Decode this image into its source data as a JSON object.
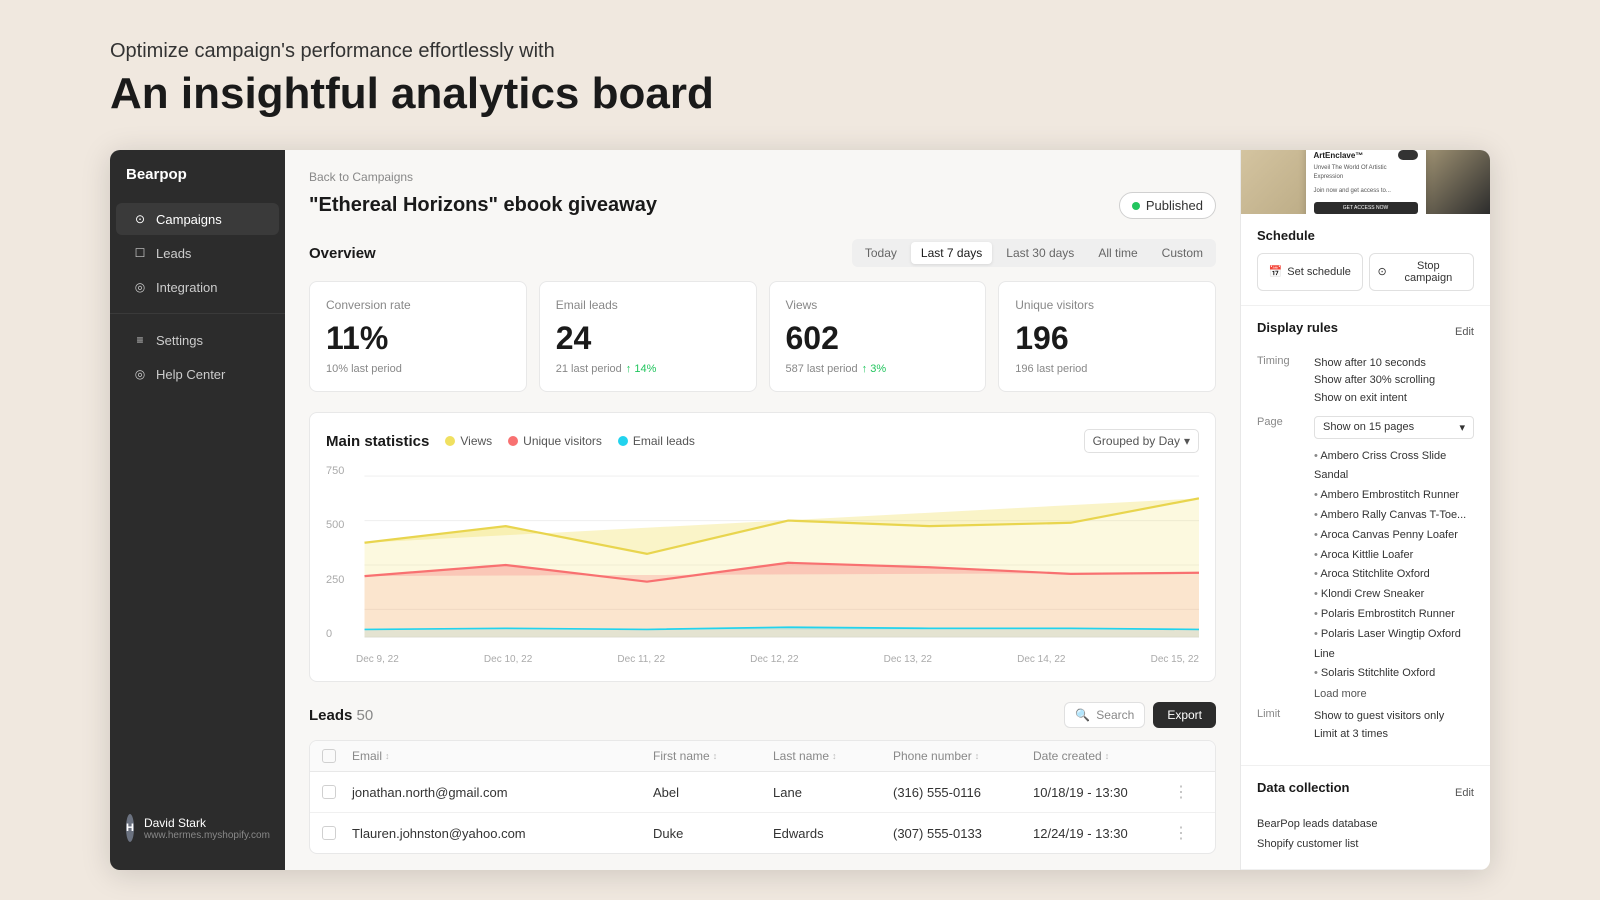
{
  "hero": {
    "subtitle": "Optimize campaign's performance effortlessly with",
    "title": "An insightful analytics board"
  },
  "sidebar": {
    "brand": "Bearpop",
    "nav_items": [
      {
        "id": "campaigns",
        "label": "Campaigns",
        "icon": "⊙",
        "active": true
      },
      {
        "id": "leads",
        "label": "Leads",
        "icon": "☐",
        "active": false
      },
      {
        "id": "integration",
        "label": "Integration",
        "icon": "◎",
        "active": false
      },
      {
        "id": "settings",
        "label": "Settings",
        "icon": "≡",
        "active": false
      },
      {
        "id": "help",
        "label": "Help Center",
        "icon": "◎",
        "active": false
      }
    ],
    "user": {
      "name": "David Stark",
      "email": "www.hermes.myshopify.com",
      "initials": "H"
    }
  },
  "breadcrumb": "Back to Campaigns",
  "page": {
    "title": "\"Ethereal Horizons\" ebook giveaway",
    "status": "Published"
  },
  "overview": {
    "section_title": "Overview",
    "time_filters": [
      "Today",
      "Last 7 days",
      "Last 30 days",
      "All time",
      "Custom"
    ],
    "active_filter": "Last 7 days",
    "stats": [
      {
        "label": "Conversion rate",
        "value": "11%",
        "sub": "10% last period",
        "change": null
      },
      {
        "label": "Email leads",
        "value": "24",
        "sub": "21 last period",
        "change": "↑ 14%"
      },
      {
        "label": "Views",
        "value": "602",
        "sub": "587 last period",
        "change": "↑ 3%"
      },
      {
        "label": "Unique visitors",
        "value": "196",
        "sub": "196 last period",
        "change": "–"
      }
    ]
  },
  "chart": {
    "title": "Main statistics",
    "legend": [
      {
        "label": "Views",
        "color": "#f0e060"
      },
      {
        "label": "Unique visitors",
        "color": "#f87171"
      },
      {
        "label": "Email leads",
        "color": "#22d3ee"
      }
    ],
    "grouped_by": "Grouped by Day",
    "y_labels": [
      "750",
      "500",
      "250",
      "0"
    ],
    "x_labels": [
      "Dec 9, 22",
      "Dec 10, 22",
      "Dec 11, 22",
      "Dec 12, 22",
      "Dec 13, 22",
      "Dec 14, 22",
      "Dec 15, 22"
    ]
  },
  "leads": {
    "section_title": "Leads",
    "count": 50,
    "search_placeholder": "Search",
    "export_label": "Export",
    "table_headers": [
      "Email",
      "First name",
      "Last name",
      "Phone number",
      "Date created"
    ],
    "rows": [
      {
        "email": "jonathan.north@gmail.com",
        "first_name": "Abel",
        "last_name": "Lane",
        "phone": "(316) 555-0116",
        "date": "10/18/19 - 13:30"
      },
      {
        "email": "Tlauren.johnston@yahoo.com",
        "first_name": "Duke",
        "last_name": "Edwards",
        "phone": "(307) 555-0133",
        "date": "12/24/19 - 13:30"
      }
    ]
  },
  "right_panel": {
    "schedule": {
      "title": "Schedule",
      "set_schedule_label": "Set schedule",
      "stop_campaign_label": "Stop campaign"
    },
    "display_rules": {
      "title": "Display rules",
      "edit_label": "Edit",
      "timing_label": "Timing",
      "timing_values": [
        "Show after 10 seconds",
        "Show after 30% scrolling",
        "Show on exit intent"
      ],
      "page_label": "Page",
      "page_select": "Show on 15 pages",
      "pages": [
        "Ambero Criss Cross Slide Sandal",
        "Ambero Embrostitch Runner",
        "Ambero Rally Canvas T-Toe...",
        "Aroca Canvas Penny Loafer",
        "Aroca Kittlie Loafer",
        "Aroca Stitchlite Oxford",
        "Klondi Crew Sneaker",
        "Polaris Embrostitch Runner",
        "Polaris Laser Wingtip Oxford Line",
        "Solaris Stitchlite Oxford"
      ],
      "load_more": "Load more",
      "limit_label": "Limit",
      "limit_values": [
        "Show to guest visitors only",
        "Limit at 3 times"
      ]
    },
    "data_collection": {
      "title": "Data collection",
      "edit_label": "Edit",
      "items": [
        "BearPop leads database",
        "Shopify customer list"
      ]
    },
    "preview": {
      "brand": "ArtEnclave™",
      "subtitle": "Unveil The World Of Artistic Expression",
      "body": "Join now and get access to...",
      "button_text": "GET ACCESS NOW"
    }
  }
}
